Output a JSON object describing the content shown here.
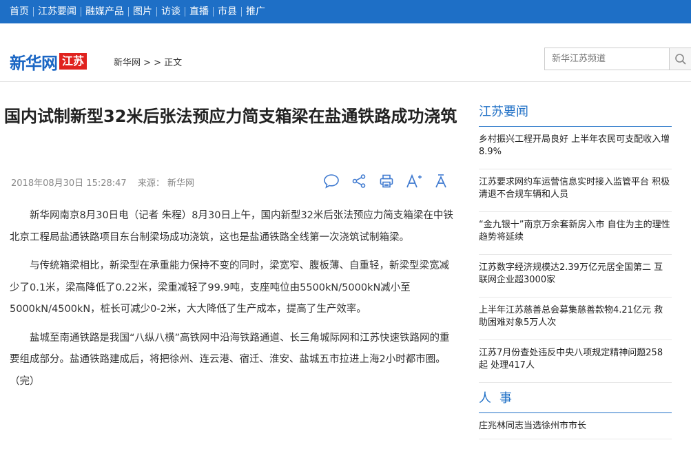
{
  "nav": {
    "items": [
      "首页",
      "江苏要闻",
      "融媒产品",
      "图片",
      "访谈",
      "直播",
      "市县",
      "推广"
    ]
  },
  "header": {
    "logo_main": "新华网",
    "logo_badge": "江苏",
    "breadcrumb": "新华网 >  > 正文",
    "search_placeholder": "新华江苏频道"
  },
  "article": {
    "title": "国内试制新型32米后张法预应力简支箱梁在盐通铁路成功浇筑",
    "datetime": "2018年08月30日 15:28:47",
    "source": "来源： 新华网",
    "tools": [
      "comment-icon",
      "share-icon",
      "print-icon",
      "font-increase-icon",
      "font-decrease-icon"
    ],
    "paragraphs": [
      "新华网南京8月30日电（记者 朱程）8月30日上午，国内新型32米后张法预应力简支箱梁在中铁北京工程局盐通铁路项目东台制梁场成功浇筑，这也是盐通铁路全线第一次浇筑试制箱梁。",
      "与传统箱梁相比，新梁型在承重能力保持不变的同时，梁宽窄、腹板薄、自重轻，新梁型梁宽减少了0.1米，梁高降低了0.22米，梁重减轻了99.9吨，支座吨位由5500kN/5000kN减小至5000kN/4500kN，桩长可减少0-2米，大大降低了生产成本，提高了生产效率。",
      "盐城至南通铁路是我国“八纵八横”高铁网中沿海铁路通道、长三角城际网和江苏快速铁路网的重要组成部分。盐通铁路建成后，将把徐州、连云港、宿迁、淮安、盐城五市拉进上海2小时都市圈。（完）"
    ]
  },
  "sidebar": {
    "news_heading": "江苏要闻",
    "news": [
      "乡村振兴工程开局良好 上半年农民可支配收入增8.9%",
      "江苏要求网约车运营信息实时接入监管平台 积极清退不合规车辆和人员",
      "“金九银十”南京万余套新房入市 自住为主的理性趋势将延续",
      "江苏数字经济规模达2.39万亿元居全国第二 互联网企业超3000家",
      "上半年江苏慈善总会募集慈善款物4.21亿元 救助困难对象5万人次",
      "江苏7月份查处违反中央八项规定精神问题258起 处理417人"
    ],
    "people_heading": "人事",
    "people": [
      "庄兆林同志当选徐州市市长"
    ]
  },
  "colors": {
    "nav_bg": "#1e6fc6",
    "accent": "#1e6fc6",
    "badge": "#e0221e"
  }
}
